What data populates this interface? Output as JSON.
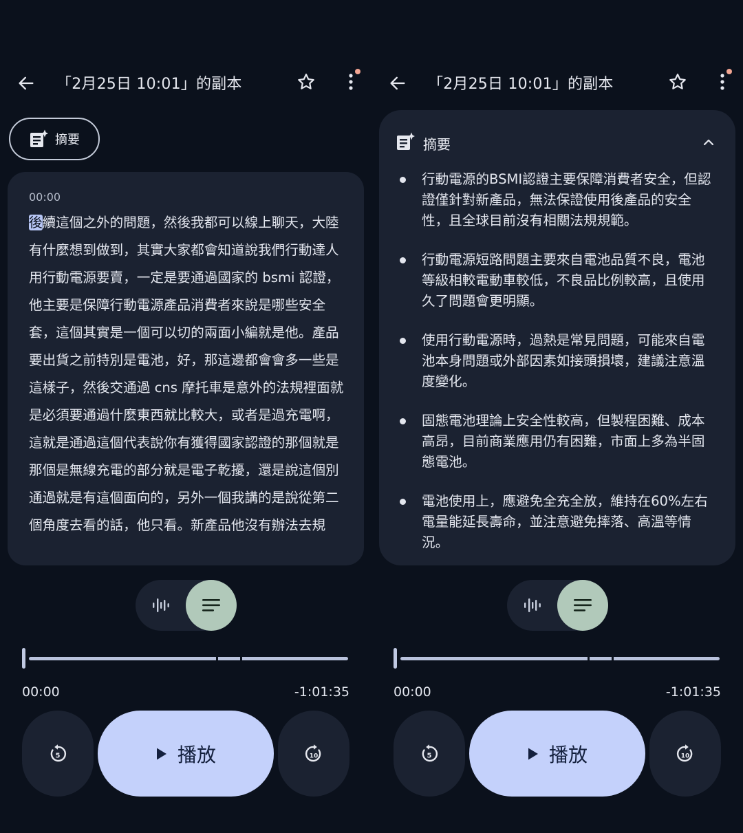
{
  "header": {
    "title": "「2月25日 10:01」的副本"
  },
  "left": {
    "summary_chip_label": "摘要",
    "transcript": {
      "timestamp": "00:00",
      "highlight_char": "後",
      "text_rest": "續這個之外的問題，然後我都可以線上聊天，大陸有什麼想到做到，其實大家都會知道說我們行動達人用行動電源要賣，一定是要通過國家的 bsmi 認證，他主要是保障行動電源產品消費者來說是哪些安全套，這個其實是一個可以切的兩面小編就是他。產品要出貨之前特別是電池，好，那這邊都會會多一些是這樣子，然後交通過 cns 摩托車是意外的法規裡面就是必須要通過什麼東西就比較大，或者是過充電啊，這就是通過這個代表說你有獲得國家認證的那個就是那個是無線充電的部分就是電子乾擾，還是說這個別通過就是有這個面向的，另外一個我講的是說從第二個角度去看的話，他只看。新產品他沒有辦法去規"
    }
  },
  "right": {
    "summary": {
      "label": "摘要",
      "bullets": [
        "行動電源的BSMI認證主要保障消費者安全，但認證僅針對新產品，無法保證使用後產品的安全性，且全球目前沒有相關法規規範。",
        "行動電源短路問題主要來自電池品質不良，電池等級相較電動車較低，不良品比例較高，且使用久了問題會更明顯。",
        "使用行動電源時，過熱是常見問題，可能來自電池本身問題或外部因素如接頭損壞，建議注意溫度變化。",
        "固態電池理論上安全性較高，但製程困難、成本高昂，目前商業應用仍有困難，市面上多為半固態電池。",
        "電池使用上，應避免全充全放，維持在60%左右電量能延長壽命，並注意避免摔落、高溫等情況。"
      ]
    }
  },
  "player": {
    "current_time": "00:00",
    "remaining_time": "-1:01:35",
    "play_label": "播放",
    "skip_back_seconds": "5",
    "skip_forward_seconds": "10",
    "progress_fraction": 0
  },
  "colors": {
    "background": "#0b111c",
    "card": "#1b2231",
    "play_button": "#c4d1fb",
    "toggle_active": "#b1c9ba",
    "notification_dot": "#f2a592"
  }
}
